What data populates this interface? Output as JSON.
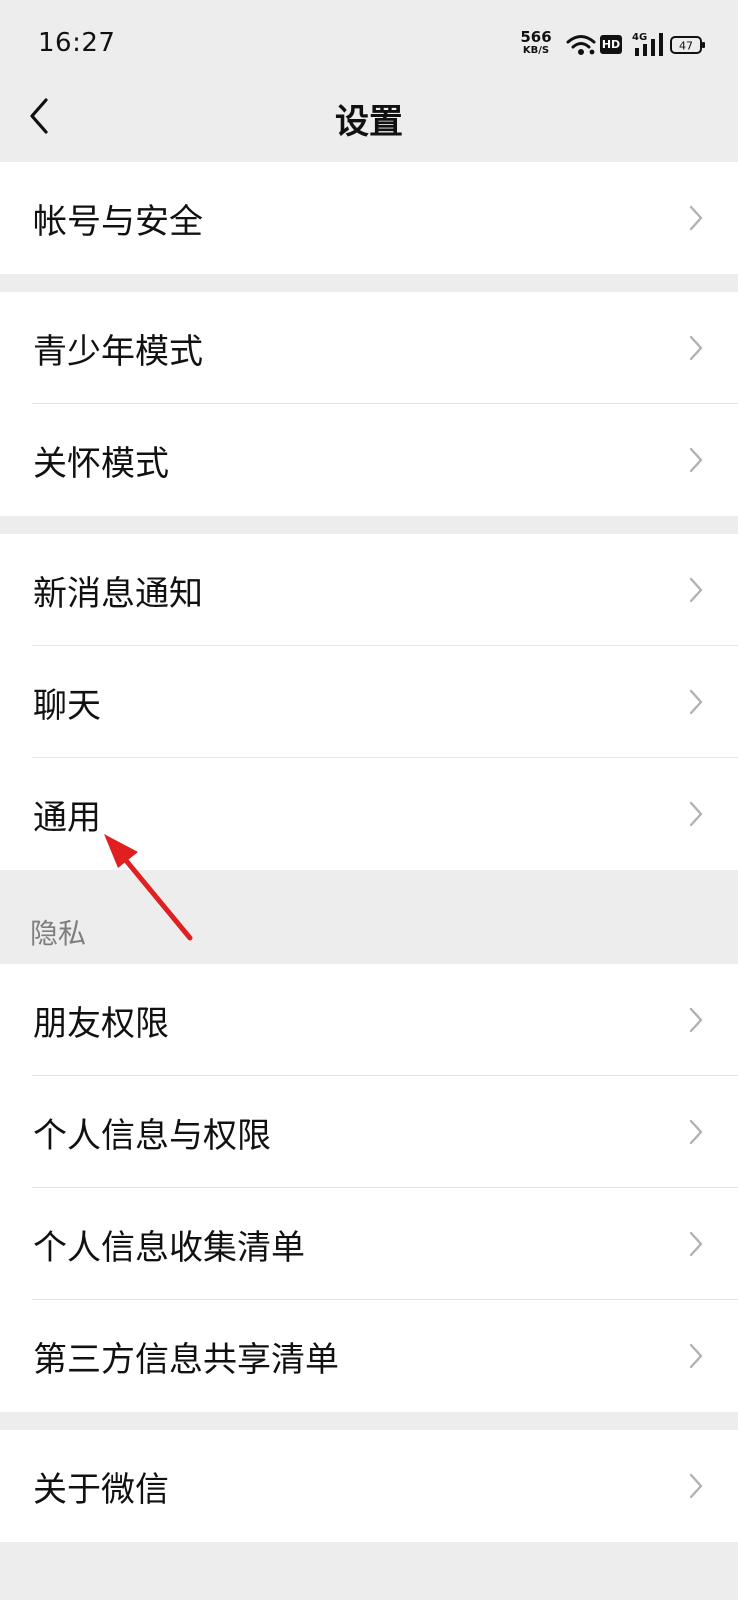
{
  "status_bar": {
    "time": "16:27",
    "net_speed_value": "566",
    "net_speed_unit": "KB/S",
    "hd_label": "HD",
    "network_type": "4G",
    "battery_level": "47"
  },
  "nav": {
    "title": "设置"
  },
  "groups": [
    {
      "items": [
        "帐号与安全"
      ]
    },
    {
      "items": [
        "青少年模式",
        "关怀模式"
      ]
    },
    {
      "items": [
        "新消息通知",
        "聊天",
        "通用"
      ]
    },
    {
      "section_title": "隐私",
      "items": [
        "朋友权限",
        "个人信息与权限",
        "个人信息收集清单",
        "第三方信息共享清单"
      ]
    },
    {
      "items": [
        "关于微信"
      ]
    }
  ],
  "colors": {
    "page_background": "#ededed",
    "cell_background": "#ffffff",
    "annotation_arrow": "#e02020"
  }
}
